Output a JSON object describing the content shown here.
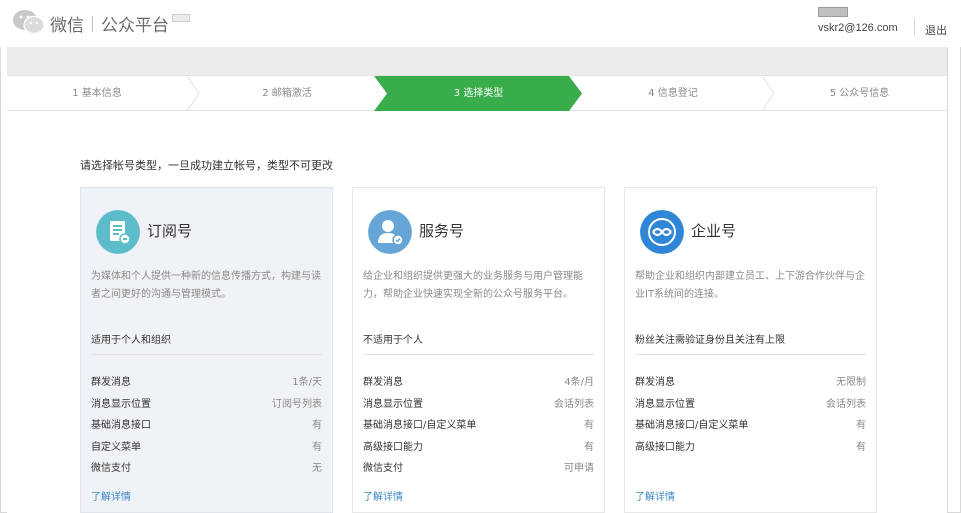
{
  "header": {
    "logo_icon": "wechat-logo-icon",
    "brand_name": "微信",
    "platform_name": "公众平台",
    "user_email": "vskr2@126.com",
    "logout_label": "退出"
  },
  "steps": [
    {
      "label": "1 基本信息",
      "active": false
    },
    {
      "label": "2 邮箱激活",
      "active": false
    },
    {
      "label": "3 选择类型",
      "active": true
    },
    {
      "label": "4 信息登记",
      "active": false
    },
    {
      "label": "5 公众号信息",
      "active": false
    }
  ],
  "colors": {
    "accent_green": "#39ac4b",
    "link_blue": "#3d86c8",
    "subscription_icon": "#5dbcc9",
    "service_icon": "#67a5d7",
    "enterprise_icon": "#2f86d6"
  },
  "instruction": "请选择帐号类型，一旦成功建立帐号，类型不可更改",
  "cards": [
    {
      "icon": "subscription-doc-icon",
      "title": "订阅号",
      "desc": "为媒体和个人提供一种新的信息传播方式，构建与读者之间更好的沟通与管理模式。",
      "fit": "适用于个人和组织",
      "features": [
        {
          "name": "群发消息",
          "value": "1条/天"
        },
        {
          "name": "消息显示位置",
          "value": "订阅号列表"
        },
        {
          "name": "基础消息接口",
          "value": "有"
        },
        {
          "name": "自定义菜单",
          "value": "有"
        },
        {
          "name": "微信支付",
          "value": "无"
        }
      ],
      "more": "了解详情"
    },
    {
      "icon": "service-user-icon",
      "title": "服务号",
      "desc": "给企业和组织提供更强大的业务服务与用户管理能力，帮助企业快速实现全新的公众号服务平台。",
      "fit": "不适用于个人",
      "features": [
        {
          "name": "群发消息",
          "value": "4条/月"
        },
        {
          "name": "消息显示位置",
          "value": "会话列表"
        },
        {
          "name": "基础消息接口/自定义菜单",
          "value": "有"
        },
        {
          "name": "高级接口能力",
          "value": "有"
        },
        {
          "name": "微信支付",
          "value": "可申请"
        }
      ],
      "more": "了解详情"
    },
    {
      "icon": "enterprise-link-icon",
      "title": "企业号",
      "desc": "帮助企业和组织内部建立员工、上下游合作伙伴与企业IT系统间的连接。",
      "fit": "粉丝关注需验证身份且关注有上限",
      "features": [
        {
          "name": "群发消息",
          "value": "无限制"
        },
        {
          "name": "消息显示位置",
          "value": "会话列表"
        },
        {
          "name": "基础消息接口/自定义菜单",
          "value": "有"
        },
        {
          "name": "高级接口能力",
          "value": "有"
        }
      ],
      "more": "了解详情"
    }
  ]
}
